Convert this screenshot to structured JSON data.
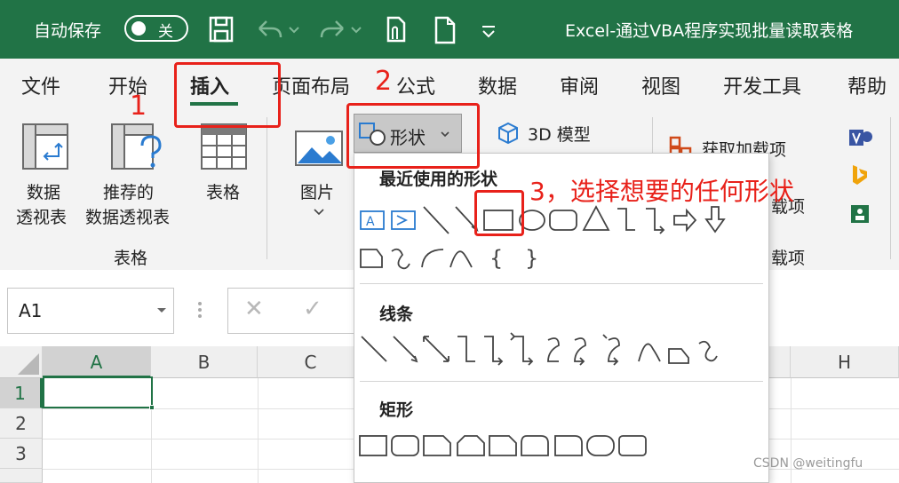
{
  "titlebar": {
    "autosave_label": "自动保存",
    "autosave_state": "关",
    "doc_title": "Excel-通过VBA程序实现批量读取表格",
    "icons": [
      "save-icon",
      "undo-icon",
      "redo-icon",
      "touch-mode-icon",
      "new-file-icon",
      "customize-icon"
    ]
  },
  "tabs": [
    "文件",
    "开始",
    "插入",
    "页面布局",
    "公式",
    "数据",
    "审阅",
    "视图",
    "开发工具",
    "帮助"
  ],
  "active_tab": "插入",
  "ribbon": {
    "pivot_table": [
      "数据",
      "透视表"
    ],
    "recommended_pivot": [
      "推荐的",
      "数据透视表"
    ],
    "table": "表格",
    "group_tables": "表格",
    "pictures": "图片",
    "shapes": "形状",
    "model3d": "3D 模型",
    "get_addins": "获取加载项",
    "my_addins_partial": "载项",
    "group_addins_partial": "载项"
  },
  "dropdown": {
    "recent_label": "最近使用的形状",
    "lines_label": "线条",
    "rect_label": "矩形"
  },
  "formula_bar": {
    "namebox": "A1",
    "cancel": "✕",
    "enter": "✓"
  },
  "grid": {
    "columns": [
      "A",
      "B",
      "C",
      "H"
    ],
    "rows": [
      "1",
      "2",
      "3"
    ]
  },
  "annotations": {
    "step1": "1",
    "step2": "2",
    "step3": "3，选择想要的任何形状"
  },
  "watermark": "CSDN @weitingfu",
  "colors": {
    "excel_green": "#217346",
    "annotation_red": "#e8211a"
  }
}
